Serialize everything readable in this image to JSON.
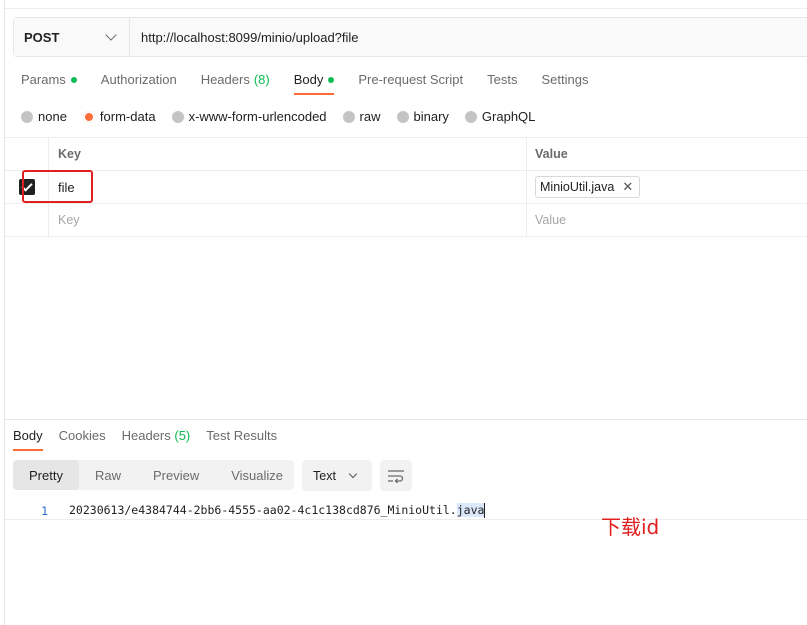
{
  "request": {
    "method": "POST",
    "url": "http://localhost:8099/minio/upload?file"
  },
  "request_tabs": [
    {
      "label": "Params",
      "indicator": "dot"
    },
    {
      "label": "Authorization"
    },
    {
      "label": "Headers",
      "count": "(8)"
    },
    {
      "label": "Body",
      "indicator": "dot",
      "active": true
    },
    {
      "label": "Pre-request Script"
    },
    {
      "label": "Tests"
    },
    {
      "label": "Settings"
    }
  ],
  "body_types": [
    {
      "label": "none"
    },
    {
      "label": "form-data",
      "selected": true
    },
    {
      "label": "x-www-form-urlencoded"
    },
    {
      "label": "raw"
    },
    {
      "label": "binary"
    },
    {
      "label": "GraphQL"
    }
  ],
  "form_table": {
    "headers": {
      "key": "Key",
      "value": "Value"
    },
    "rows": [
      {
        "checked": true,
        "key": "file",
        "value": "MinioUtil.java",
        "remove_icon": "close-icon"
      }
    ],
    "new_row": {
      "key_placeholder": "Key",
      "value_placeholder": "Value"
    }
  },
  "response_tabs": [
    {
      "label": "Body",
      "active": true
    },
    {
      "label": "Cookies"
    },
    {
      "label": "Headers",
      "count": "(5)"
    },
    {
      "label": "Test Results"
    }
  ],
  "view_modes": [
    {
      "label": "Pretty",
      "active": true
    },
    {
      "label": "Raw"
    },
    {
      "label": "Preview"
    },
    {
      "label": "Visualize"
    }
  ],
  "format": {
    "selected": "Text"
  },
  "wrap_icon": "wrap-lines-icon",
  "response_body": {
    "line_number": "1",
    "text_main": "20230613/e4384744-2bb6-4555-aa02-4c1c138cd876_MinioUtil.",
    "text_selected": "java"
  },
  "annotation": "下载id",
  "colors": {
    "accent": "#ff6c37",
    "indicator": "#0cbb52",
    "highlight": "#e02020"
  }
}
